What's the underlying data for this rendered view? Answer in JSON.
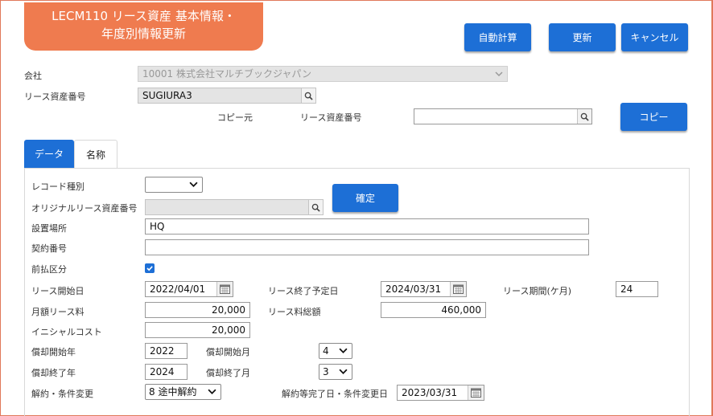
{
  "header": {
    "title_line1": "LECM110 リース資産 基本情報・",
    "title_line2": "年度別情報更新",
    "auto_calc_label": "自動計算",
    "update_label": "更新",
    "cancel_label": "キャンセル"
  },
  "company": {
    "label": "会社",
    "value": "10001 株式会社マルチブックジャパン"
  },
  "lease_asset_no": {
    "label": "リース資産番号",
    "value": "SUGIURA3"
  },
  "copy": {
    "source_label": "コピー元",
    "asset_no_label": "リース資産番号",
    "value": "",
    "button_label": "コピー"
  },
  "tabs": [
    {
      "label": "データ",
      "active": true
    },
    {
      "label": "名称",
      "active": false
    }
  ],
  "form": {
    "record_type_label": "レコード種別",
    "record_type_value": "",
    "confirm_label": "確定",
    "original_asset_no_label": "オリジナルリース資産番号",
    "original_asset_no_value": "",
    "location_label": "設置場所",
    "location_value": "HQ",
    "contract_no_label": "契約番号",
    "contract_no_value": "",
    "prepaid_label": "前払区分",
    "prepaid_checked": true,
    "lease_start_label": "リース開始日",
    "lease_start_value": "2022/04/01",
    "lease_end_label": "リース終了予定日",
    "lease_end_value": "2024/03/31",
    "lease_period_label": "リース期間(ケ月)",
    "lease_period_value": "24",
    "monthly_fee_label": "月額リース料",
    "monthly_fee_value": "20,000",
    "total_fee_label": "リース料総額",
    "total_fee_value": "460,000",
    "initial_cost_label": "イニシャルコスト",
    "initial_cost_value": "20,000",
    "dep_start_year_label": "償却開始年",
    "dep_start_year_value": "2022",
    "dep_start_month_label": "償却開始月",
    "dep_start_month_value": "4",
    "dep_end_year_label": "償却終了年",
    "dep_end_year_value": "2024",
    "dep_end_month_label": "償却終了月",
    "dep_end_month_value": "3",
    "cancel_change_label": "解約・条件変更",
    "cancel_change_value": "8 途中解約",
    "cancel_date_label": "解約等完了日・条件変更日",
    "cancel_date_value": "2023/03/31"
  },
  "colors": {
    "accent": "#1d6fd6",
    "title_bg": "#ef7b4f"
  }
}
